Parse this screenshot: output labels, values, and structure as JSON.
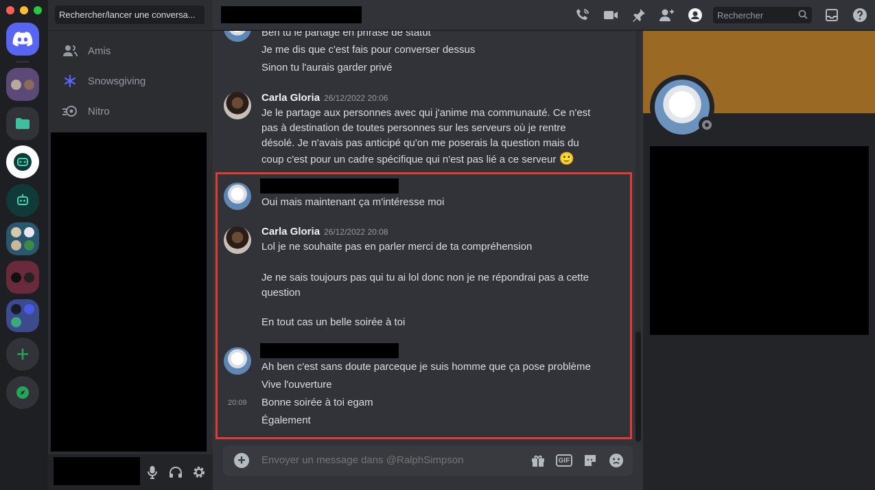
{
  "colors": {
    "accent": "#5865f2",
    "highlight_border": "#e53935",
    "banner": "#9a6a24",
    "online_green": "#23a55a"
  },
  "sidebar": {
    "search_placeholder": "Rechercher/lancer une conversa...",
    "items": [
      {
        "label": "Amis",
        "icon": "friends-icon"
      },
      {
        "label": "Snowsgiving",
        "icon": "snowflake-icon"
      },
      {
        "label": "Nitro",
        "icon": "nitro-icon"
      }
    ]
  },
  "header": {
    "icons": [
      "start-voice-call-icon",
      "start-video-call-icon",
      "pinned-messages-icon",
      "add-friends-icon",
      "user-profile-icon"
    ],
    "search_placeholder": "Rechercher",
    "right_icons": [
      "inbox-icon",
      "help-icon"
    ]
  },
  "messages": [
    {
      "lines": [
        "Ben tu le partage en phrase de statut"
      ]
    },
    {
      "lines": [
        "Je me dis que c'est fais pour converser dessus"
      ]
    },
    {
      "lines": [
        "Sinon tu l'aurais garder privé"
      ]
    },
    {
      "author": "Carla Gloria",
      "timestamp": "26/12/2022 20:06",
      "text": "Je le partage aux personnes avec qui j'anime ma communauté. Ce n'est pas à destination de toutes personnes sur les serveurs où je rentre désolé. Je n'avais pas anticipé qu'on me poserais la question mais du coup c'est pour un cadre spécifique qui n'est pas lié a ce serveur",
      "emoji": "🙂"
    },
    {
      "text": "Oui mais maintenant ça m'intéresse moi"
    },
    {
      "author": "Carla Gloria",
      "timestamp": "26/12/2022 20:08",
      "lines": [
        "Lol je ne souhaite pas en parler merci de ta compréhension",
        "Je ne sais toujours pas qui tu ai lol donc non je ne répondrai pas a cette question",
        "En tout cas un belle soirée à toi"
      ]
    },
    {
      "lines": [
        "Ah ben c'est sans doute parceque je suis homme que ça pose problème",
        "Vive l'ouverture",
        "Bonne soirée à toi egam",
        "Également"
      ],
      "side_time": "20:09"
    }
  ],
  "composer": {
    "placeholder": "Envoyer un message dans @RalphSimpson",
    "gif_label": "GIF"
  }
}
